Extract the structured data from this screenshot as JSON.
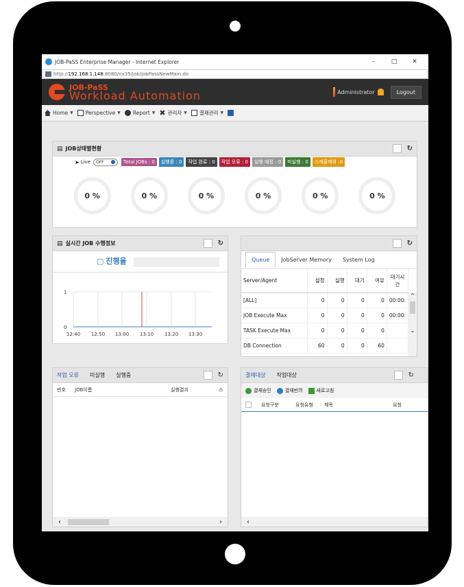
{
  "window": {
    "title": "JOB-PaSS Enterprise Manager - Internet Explorer",
    "url_prefix": "http://",
    "url_host": "192.168.1.148",
    "url_path": ":8080/nx35/job/jobPassNewMain.do"
  },
  "header": {
    "logo_top": "JOB-PaSS",
    "logo_bottom": "Workload Automation",
    "user": "Administrator",
    "logout": "Logout"
  },
  "menu": [
    "Home",
    "Perspective",
    "Report",
    "관리자",
    "결재관리"
  ],
  "job_status": {
    "title": "JOB상태별현황",
    "live_label": "Live",
    "toggle_label": "OFF",
    "badges": [
      {
        "label": "Total JOBs : 0",
        "color": "#b0568c"
      },
      {
        "label": "실행중 : 0",
        "color": "#3a86b8"
      },
      {
        "label": "작업 완료 : 0",
        "color": "#444444"
      },
      {
        "label": "작업 오류 : 0",
        "color": "#b3203a"
      },
      {
        "label": "실행 예정 : 0",
        "color": "#9a9a9a"
      },
      {
        "label": "미실행 : 0",
        "color": "#3c7a35"
      },
      {
        "label": "스케줄제외 :0",
        "color": "#e09b12"
      }
    ],
    "percents": [
      "0 %",
      "0 %",
      "0 %",
      "0 %",
      "0 %",
      "0 %"
    ]
  },
  "realtime": {
    "title": "실시간 JOB 수행정보",
    "progress_label": "진행율",
    "y_ticks": [
      "1",
      "0"
    ],
    "x_ticks": [
      "12:40",
      "12:50",
      "13:00",
      "13:10",
      "13:20",
      "13:30"
    ]
  },
  "queue_panel": {
    "tabs": [
      "Queue",
      "JobServer Memory",
      "System Log"
    ],
    "columns": [
      "Server/Agent",
      "설정",
      "실행",
      "대기",
      "여유",
      "대기시간"
    ],
    "rows": [
      [
        "[ALL]",
        "0",
        "0",
        "0",
        "0",
        "00:00:"
      ],
      [
        "JOB Execute Max",
        "0",
        "0",
        "0",
        "0",
        "00:00:"
      ],
      [
        "TASK Execute Max",
        "0",
        "0",
        "0",
        "0",
        ""
      ],
      [
        "DB Connection",
        "60",
        "0",
        "0",
        "60",
        ""
      ]
    ]
  },
  "error_panel": {
    "tabs": [
      "작업 오류",
      "미실행",
      "실행중"
    ],
    "columns": [
      "번호",
      "JOB이름",
      "실행결과",
      "스"
    ]
  },
  "approval_panel": {
    "tabs": [
      "결재대상",
      "작업대상"
    ],
    "actions": [
      "결재승인",
      "결재반려",
      "새로고침"
    ],
    "columns": [
      "요청구분",
      "요청유형",
      "제목",
      "요청"
    ]
  }
}
